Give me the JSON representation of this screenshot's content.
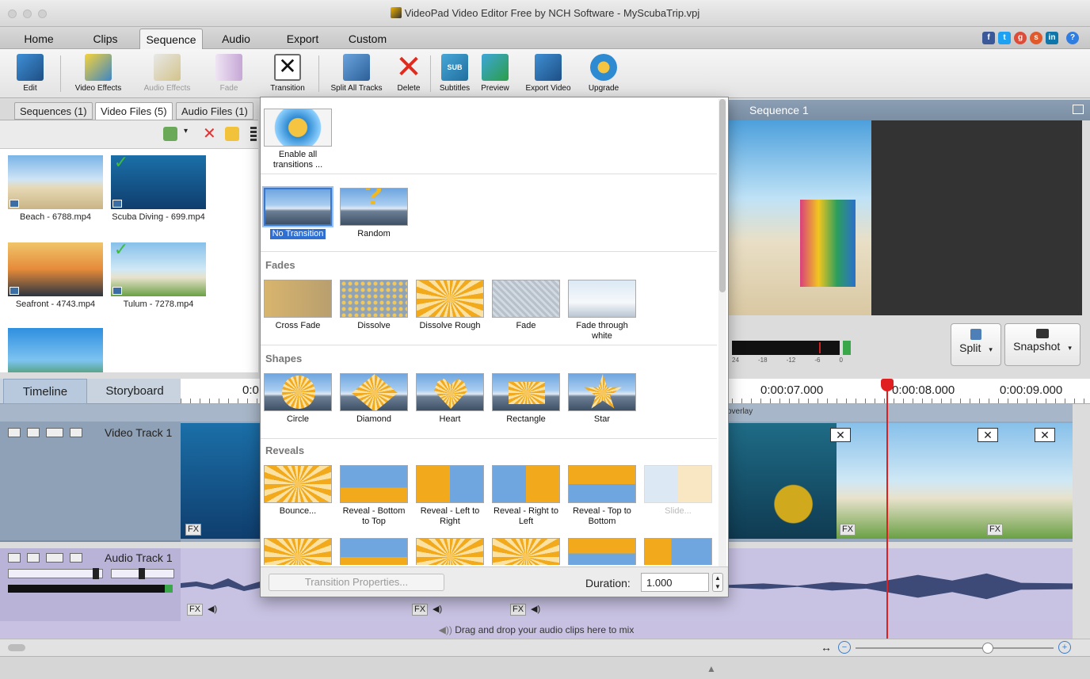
{
  "window": {
    "title": "VideoPad Video Editor Free by NCH Software - MyScubaTrip.vpj"
  },
  "menu": {
    "tabs": [
      "Home",
      "Clips",
      "Sequence",
      "Audio",
      "Export",
      "Custom"
    ],
    "active": "Sequence"
  },
  "toolbar": {
    "edit": "Edit",
    "video_effects": "Video Effects",
    "audio_effects": "Audio Effects",
    "fade": "Fade",
    "transition": "Transition",
    "split_all": "Split All Tracks",
    "delete": "Delete",
    "subtitles": "Subtitles",
    "preview": "Preview",
    "export_video": "Export Video",
    "upgrade": "Upgrade",
    "sub_text": "SUB"
  },
  "bins": {
    "tabs": [
      "Sequences (1)",
      "Video Files (5)",
      "Audio Files (1)"
    ],
    "clips": [
      {
        "name": "Beach - 6788.mp4"
      },
      {
        "name": "Scuba Diving - 699.mp4"
      },
      {
        "name": "Seafront - 4743.mp4"
      },
      {
        "name": "Tulum - 7278.mp4"
      }
    ]
  },
  "preview": {
    "title": "Sequence 1",
    "meter_ticks": [
      "24",
      "-18",
      "-12",
      "-6",
      "0"
    ],
    "split": "Split",
    "snapshot": "Snapshot"
  },
  "timeline": {
    "tabs": [
      "Timeline",
      "Storyboard"
    ],
    "ruler": [
      "0:0",
      "0:00:07.000",
      "0:00:08.000",
      "0:00:09.000"
    ],
    "video_track": "Video Track 1",
    "audio_track": "Audio Track 1",
    "overlay_label": "overlay",
    "fx": "FX",
    "drag_hint": "Drag and drop your audio clips here to mix"
  },
  "popup": {
    "enable_all": "Enable all transitions ...",
    "basic": [
      {
        "label": "No Transition"
      },
      {
        "label": "Random"
      }
    ],
    "sections": {
      "fades": {
        "title": "Fades",
        "items": [
          "Cross Fade",
          "Dissolve",
          "Dissolve Rough",
          "Fade",
          "Fade through white"
        ]
      },
      "shapes": {
        "title": "Shapes",
        "items": [
          "Circle",
          "Diamond",
          "Heart",
          "Rectangle",
          "Star"
        ]
      },
      "reveals": {
        "title": "Reveals",
        "items": [
          "Bounce...",
          "Reveal - Bottom to Top",
          "Reveal - Left to Right",
          "Reveal - Right to Left",
          "Reveal - Top to Bottom",
          "Slide..."
        ]
      }
    },
    "properties_button": "Transition Properties...",
    "duration_label": "Duration:",
    "duration_value": "1.000"
  }
}
